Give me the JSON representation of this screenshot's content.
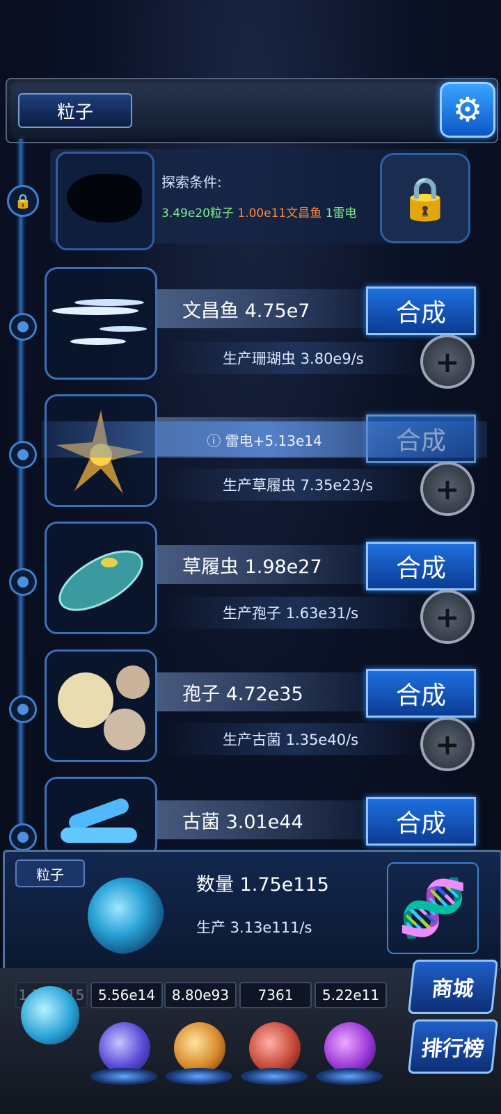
{
  "header": {
    "title": "粒子",
    "settings_icon": "gear-icon"
  },
  "locked": {
    "label": "探索条件:",
    "req1": "3.49e20粒子",
    "req2": "1.00e11文昌鱼",
    "req3": "1雷电",
    "lock_icon": "lock-icon"
  },
  "items": [
    {
      "name": "文昌鱼 4.75e7",
      "production": "生产珊瑚虫 3.80e9/s",
      "button": "合成"
    },
    {
      "name": "",
      "production": "生产草履虫 7.35e23/s",
      "button": "合成"
    },
    {
      "name": "草履虫 1.98e27",
      "production": "生产孢子 1.63e31/s",
      "button": "合成"
    },
    {
      "name": "孢子 4.72e35",
      "production": "生产古菌 1.35e40/s",
      "button": "合成"
    },
    {
      "name": "古菌 3.01e44",
      "production": "",
      "button": "合成"
    }
  ],
  "toast": "ⓘ 雷电+5.13e14",
  "resource_panel": {
    "label": "粒子",
    "quantity": "数量 1.75e115",
    "production": "生产 3.13e111/s"
  },
  "dock": {
    "values": [
      "5.56e14",
      "8.80e93",
      "7361",
      "5.22e11"
    ],
    "first_value": "1.75e115",
    "shop": "商城",
    "rank": "排行榜"
  },
  "colors": {
    "accent": "#1e70e0",
    "green": "#7ef08c",
    "orange": "#ff8a3a"
  }
}
